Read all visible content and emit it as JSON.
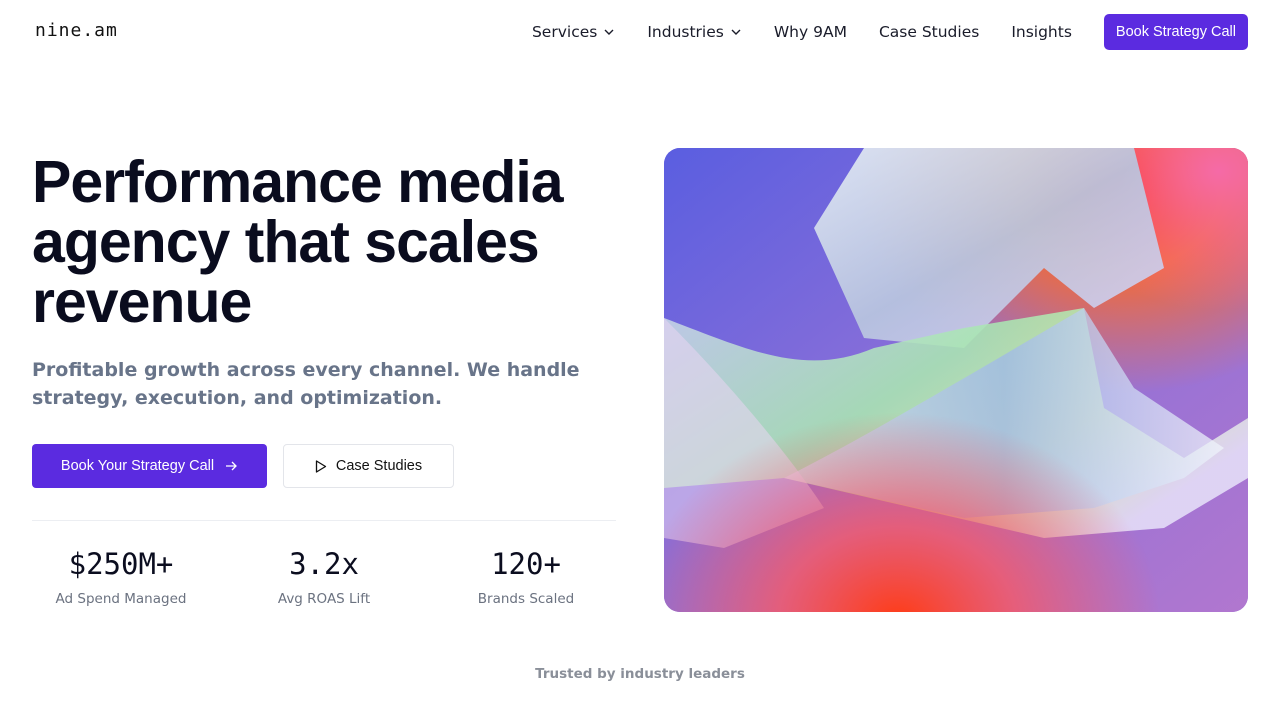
{
  "header": {
    "logo": "nine.am",
    "nav": [
      {
        "label": "Services",
        "has_dropdown": true
      },
      {
        "label": "Industries",
        "has_dropdown": true
      },
      {
        "label": "Why 9AM",
        "has_dropdown": false
      },
      {
        "label": "Case Studies",
        "has_dropdown": false
      },
      {
        "label": "Insights",
        "has_dropdown": false
      }
    ],
    "cta_label": "Book Strategy Call"
  },
  "hero": {
    "headline_lines": [
      "Performance media",
      "agency that scales",
      "revenue"
    ],
    "subhead_lines": [
      "Profitable growth across every channel. We handle",
      "strategy, execution, and optimization."
    ],
    "primary_button": {
      "label": "Book Your Strategy Call",
      "icon": "arrow-right-icon"
    },
    "secondary_button": {
      "label": "Case Studies",
      "icon": "play-icon"
    },
    "stats": [
      {
        "value": "$250M+",
        "label": "Ad Spend Managed"
      },
      {
        "value": "3.2x",
        "label": "Avg ROAS Lift"
      },
      {
        "value": "120+",
        "label": "Brands Scaled"
      }
    ],
    "image": {
      "description_icon": "abstract-gradient-image"
    }
  },
  "trusted": {
    "label": "Trusted by industry leaders"
  },
  "colors": {
    "accent": "#5b2be0",
    "text_dark": "#0a0c1e",
    "text_muted": "#687489"
  }
}
